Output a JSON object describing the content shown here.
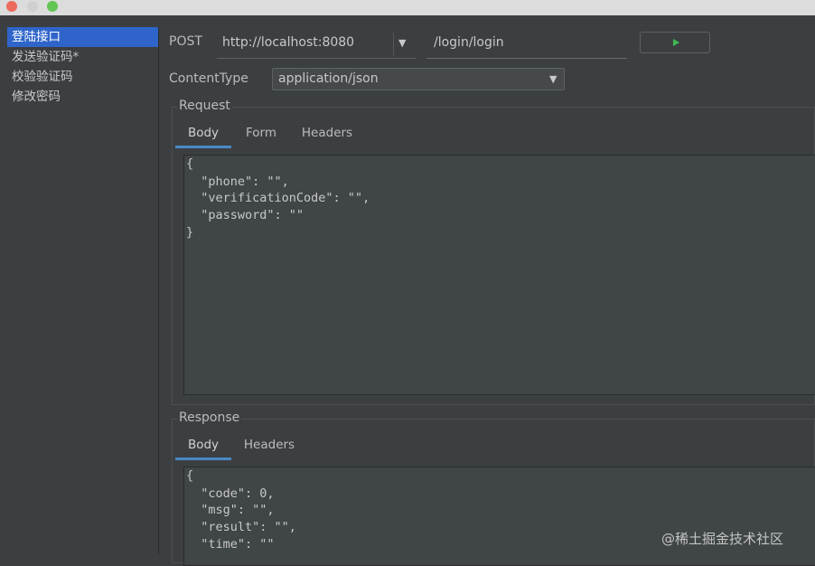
{
  "sidebar": {
    "items": [
      {
        "label": "登陆接口",
        "selected": true
      },
      {
        "label": "发送验证码*",
        "selected": false
      },
      {
        "label": "校验验证码",
        "selected": false
      },
      {
        "label": "修改密码",
        "selected": false
      }
    ]
  },
  "request_line": {
    "method": "POST",
    "host": "http://localhost:8080",
    "path": "/login/login",
    "run_icon": "play-icon"
  },
  "content_type": {
    "label": "ContentType",
    "value": "application/json"
  },
  "request": {
    "title": "Request",
    "tabs": [
      "Body",
      "Form",
      "Headers"
    ],
    "active_tab": "Body",
    "body_lines": [
      "{",
      "  \"phone\": \"\",",
      "  \"verificationCode\": \"\",",
      "  \"password\": \"\"",
      "}"
    ]
  },
  "response": {
    "title": "Response",
    "tabs": [
      "Body",
      "Headers"
    ],
    "active_tab": "Body",
    "body_lines": [
      "{",
      "  \"code\": 0,",
      "  \"msg\": \"\",",
      "  \"result\": \"\",",
      "  \"time\": \"\""
    ]
  },
  "watermark": "@稀土掘金技术社区",
  "colors": {
    "background": "#3c3f41",
    "selection": "#2f65ca",
    "tab_indicator": "#4a88c7",
    "run_icon": "#3fb950"
  }
}
